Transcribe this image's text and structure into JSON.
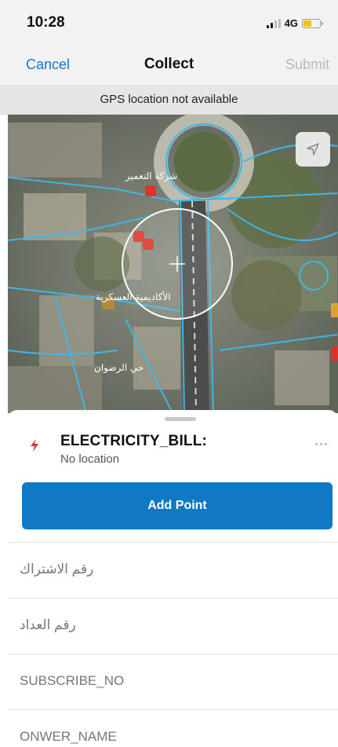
{
  "status_bar": {
    "time": "10:28",
    "network": "4G",
    "battery_color": "#f5c400"
  },
  "nav": {
    "cancel_label": "Cancel",
    "title": "Collect",
    "submit_label": "Submit"
  },
  "banner": {
    "text": "GPS location not available"
  },
  "map": {
    "locate_icon": "location-arrow-icon",
    "labels": [
      "الأكاديمية العسكرية",
      "حي الرضوان",
      "شركة التعمير"
    ]
  },
  "sheet": {
    "layer_icon": "lightning-bolt-icon",
    "layer_name": "ELECTRICITY_BILL:",
    "layer_status": "No location",
    "add_point_label": "Add Point",
    "fields": [
      {
        "label": "رقم الاشتراك"
      },
      {
        "label": "رقم العداد"
      },
      {
        "label": "SUBSCRIBE_NO"
      },
      {
        "label": "ONWER_NAME"
      }
    ]
  },
  "colors": {
    "accent": "#1a73c8",
    "button": "#0f79c4",
    "disabled": "#b9b9b9",
    "map_road_lines": "#3fb6e8"
  }
}
